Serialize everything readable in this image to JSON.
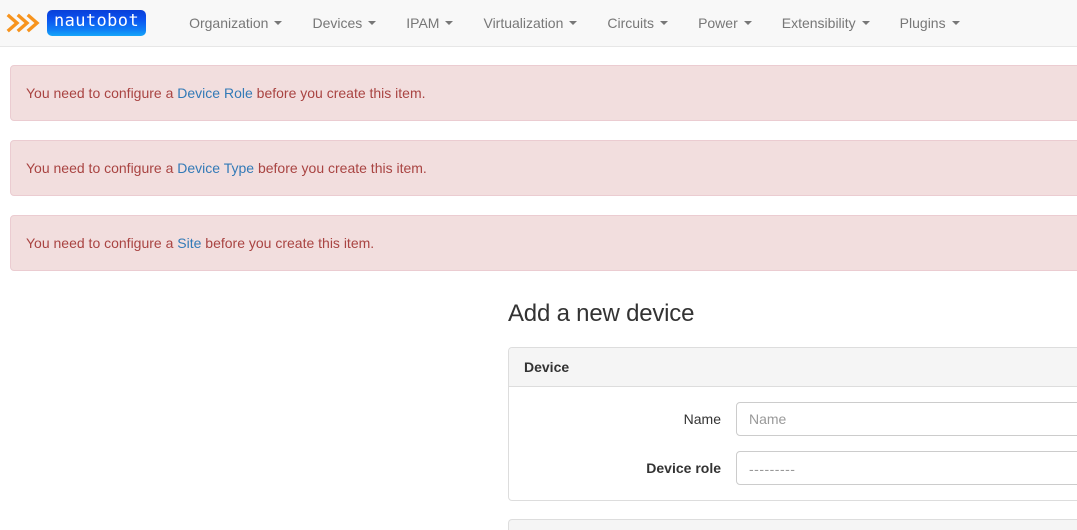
{
  "navbar": {
    "brand": {
      "chevrons_icon": "chevrons-right-icon",
      "logo_text": "nautobot"
    },
    "items": [
      {
        "label": "Organization"
      },
      {
        "label": "Devices"
      },
      {
        "label": "IPAM"
      },
      {
        "label": "Virtualization"
      },
      {
        "label": "Circuits"
      },
      {
        "label": "Power"
      },
      {
        "label": "Extensibility"
      },
      {
        "label": "Plugins"
      }
    ]
  },
  "alerts": [
    {
      "prefix": "You need to configure a ",
      "link": "Device Role",
      "suffix": " before you create this item."
    },
    {
      "prefix": "You need to configure a ",
      "link": "Device Type",
      "suffix": " before you create this item."
    },
    {
      "prefix": "You need to configure a ",
      "link": "Site",
      "suffix": " before you create this item."
    }
  ],
  "form": {
    "title": "Add a new device",
    "panel_heading": "Device",
    "fields": [
      {
        "label": "Name",
        "type": "text",
        "value": "",
        "placeholder": "Name",
        "required": false
      },
      {
        "label": "Device role",
        "type": "select",
        "value": "---------",
        "required": true
      }
    ]
  },
  "colors": {
    "alert_bg": "#f2dede",
    "alert_border": "#ebccd1",
    "alert_text": "#a94442",
    "link": "#337ab7",
    "navbar_bg": "#f8f8f8",
    "panel_heading_bg": "#f5f5f5",
    "brand_accent": "#ff7f0e",
    "brand_badge_start": "#0a3fd8",
    "brand_badge_end": "#16a6f8"
  }
}
